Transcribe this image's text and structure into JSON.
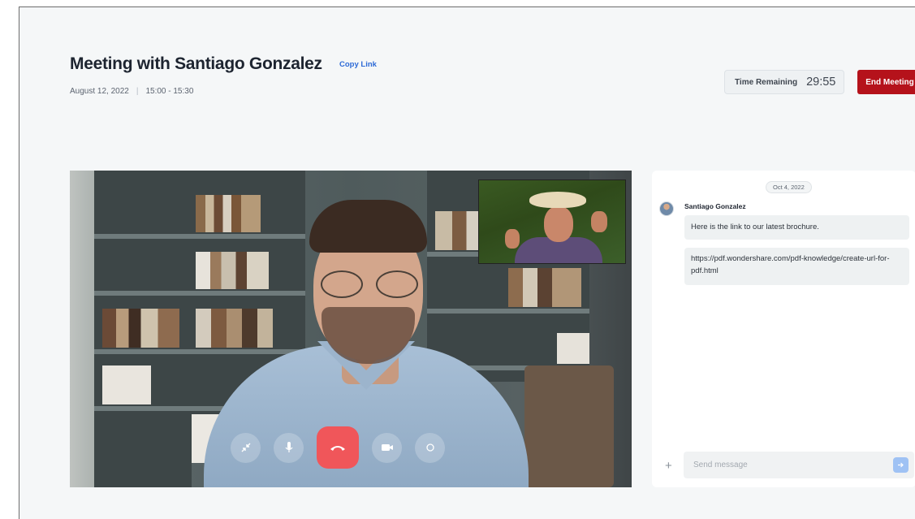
{
  "header": {
    "title": "Meeting with Santiago Gonzalez",
    "copy_link": "Copy Link",
    "date": "August 12, 2022",
    "separator": "|",
    "time_range": "15:00 - 15:30",
    "time_remaining_label": "Time Remaining",
    "time_remaining_value": "29:55",
    "end_meeting": "End Meeting"
  },
  "call_controls": [
    "collapse-icon",
    "microphone-icon",
    "hang-up-icon",
    "camera-icon",
    "record-icon"
  ],
  "chat": {
    "date": "Oct 4, 2022",
    "sender": "Santiago Gonzalez",
    "messages": [
      "Here is the link to our latest brochure.",
      "https://pdf.wondershare.com/pdf-knowledge/create-url-for-pdf.html"
    ],
    "input_placeholder": "Send message"
  },
  "colors": {
    "end_button": "#b5121b",
    "hang_up": "#f0565a",
    "copy_link": "#2d6ad6",
    "send_button": "#9fc2f4"
  }
}
